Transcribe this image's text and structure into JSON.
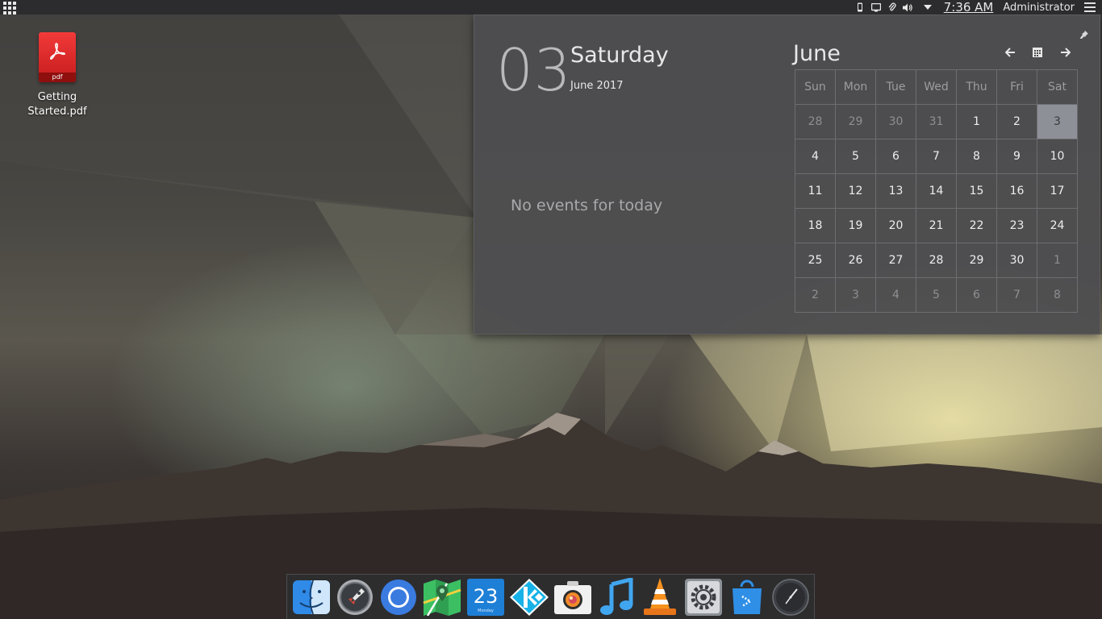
{
  "top_panel": {
    "clock": "7:36 AM",
    "user": "Administrator"
  },
  "desktop": {
    "icons": [
      {
        "label": "Getting\nStarted.pdf",
        "badge": "pdf",
        "icon": "pdf-file-icon"
      }
    ]
  },
  "calendar": {
    "day_number": "03",
    "weekday": "Saturday",
    "month_year": "June 2017",
    "no_events": "No events for today",
    "month_name": "June",
    "weekdays": [
      "Sun",
      "Mon",
      "Tue",
      "Wed",
      "Thu",
      "Fri",
      "Sat"
    ],
    "weeks": [
      [
        "28",
        "29",
        "30",
        "31",
        "1",
        "2",
        "3"
      ],
      [
        "4",
        "5",
        "6",
        "7",
        "8",
        "9",
        "10"
      ],
      [
        "11",
        "12",
        "13",
        "14",
        "15",
        "16",
        "17"
      ],
      [
        "18",
        "19",
        "20",
        "21",
        "22",
        "23",
        "24"
      ],
      [
        "25",
        "26",
        "27",
        "28",
        "29",
        "30",
        "1"
      ],
      [
        "2",
        "3",
        "4",
        "5",
        "6",
        "7",
        "8"
      ]
    ],
    "selected_day": "3"
  },
  "dock": {
    "calendar_app_day": "23",
    "calendar_app_weekday": "Monday",
    "items": [
      "finder-icon",
      "rocket-launcher-icon",
      "chromium-browser-icon",
      "maps-icon",
      "calendar-app-icon",
      "kodi-icon",
      "camera-icon",
      "music-icon",
      "vlc-icon",
      "system-settings-icon",
      "app-store-icon",
      "clock-icon"
    ]
  }
}
